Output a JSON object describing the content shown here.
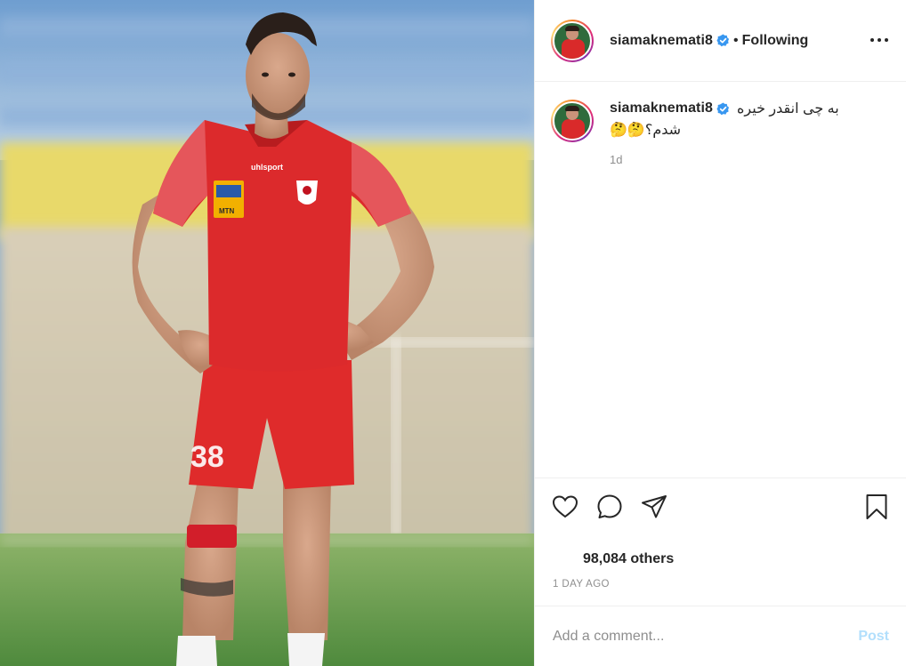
{
  "header": {
    "username": "siamaknemati8",
    "separator": "•",
    "follow_status": "Following",
    "verified_icon": "verified-badge-icon",
    "more_icon": "more-options-icon"
  },
  "caption": {
    "username": "siamaknemati8",
    "line1": "به چی انقدر خیره",
    "line2": "شدم؟🤔🤔",
    "time": "1d"
  },
  "actions": {
    "like_icon": "heart-icon",
    "comment_icon": "comment-icon",
    "share_icon": "paper-plane-icon",
    "save_icon": "bookmark-icon"
  },
  "likes": {
    "count_text": "98,084 others"
  },
  "post_date": "1 DAY AGO",
  "comment": {
    "placeholder": "Add a comment...",
    "post_label": "Post"
  },
  "colors": {
    "verified": "#3897f0",
    "text": "#262626",
    "muted": "#8e8e8e",
    "post_disabled": "#b2dffc",
    "jersey_red": "#d92a2a"
  }
}
